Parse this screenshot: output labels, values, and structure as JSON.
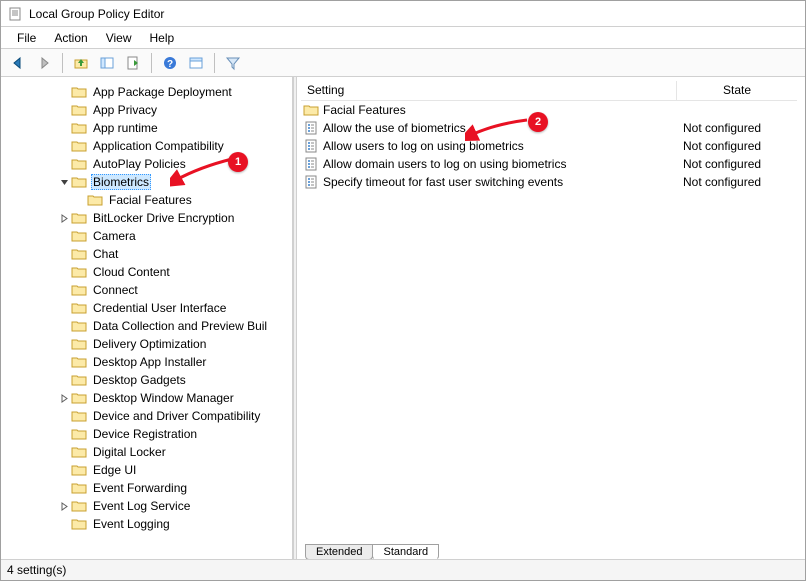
{
  "window": {
    "title": "Local Group Policy Editor"
  },
  "menubar": [
    "File",
    "Action",
    "View",
    "Help"
  ],
  "columns": {
    "setting": "Setting",
    "state": "State"
  },
  "tree": [
    {
      "label": "App Package Deployment",
      "depth": 3,
      "expander": ""
    },
    {
      "label": "App Privacy",
      "depth": 3,
      "expander": ""
    },
    {
      "label": "App runtime",
      "depth": 3,
      "expander": ""
    },
    {
      "label": "Application Compatibility",
      "depth": 3,
      "expander": ""
    },
    {
      "label": "AutoPlay Policies",
      "depth": 3,
      "expander": ""
    },
    {
      "label": "Biometrics",
      "depth": 3,
      "expander": "∨",
      "selected": true
    },
    {
      "label": "Facial Features",
      "depth": 4,
      "expander": ""
    },
    {
      "label": "BitLocker Drive Encryption",
      "depth": 3,
      "expander": ">"
    },
    {
      "label": "Camera",
      "depth": 3,
      "expander": ""
    },
    {
      "label": "Chat",
      "depth": 3,
      "expander": ""
    },
    {
      "label": "Cloud Content",
      "depth": 3,
      "expander": ""
    },
    {
      "label": "Connect",
      "depth": 3,
      "expander": ""
    },
    {
      "label": "Credential User Interface",
      "depth": 3,
      "expander": ""
    },
    {
      "label": "Data Collection and Preview Buil",
      "depth": 3,
      "expander": ""
    },
    {
      "label": "Delivery Optimization",
      "depth": 3,
      "expander": ""
    },
    {
      "label": "Desktop App Installer",
      "depth": 3,
      "expander": ""
    },
    {
      "label": "Desktop Gadgets",
      "depth": 3,
      "expander": ""
    },
    {
      "label": "Desktop Window Manager",
      "depth": 3,
      "expander": ">"
    },
    {
      "label": "Device and Driver Compatibility",
      "depth": 3,
      "expander": ""
    },
    {
      "label": "Device Registration",
      "depth": 3,
      "expander": ""
    },
    {
      "label": "Digital Locker",
      "depth": 3,
      "expander": ""
    },
    {
      "label": "Edge UI",
      "depth": 3,
      "expander": ""
    },
    {
      "label": "Event Forwarding",
      "depth": 3,
      "expander": ""
    },
    {
      "label": "Event Log Service",
      "depth": 3,
      "expander": ">"
    },
    {
      "label": "Event Logging",
      "depth": 3,
      "expander": ""
    }
  ],
  "details": [
    {
      "type": "folder",
      "label": "Facial Features",
      "state": ""
    },
    {
      "type": "policy",
      "label": "Allow the use of biometrics",
      "state": "Not configured"
    },
    {
      "type": "policy",
      "label": "Allow users to log on using biometrics",
      "state": "Not configured"
    },
    {
      "type": "policy",
      "label": "Allow domain users to log on using biometrics",
      "state": "Not configured"
    },
    {
      "type": "policy",
      "label": "Specify timeout for fast user switching events",
      "state": "Not configured"
    }
  ],
  "tabs": {
    "extended": "Extended",
    "standard": "Standard"
  },
  "statusbar": "4 setting(s)",
  "annotations": {
    "badge1": "1",
    "badge2": "2"
  }
}
